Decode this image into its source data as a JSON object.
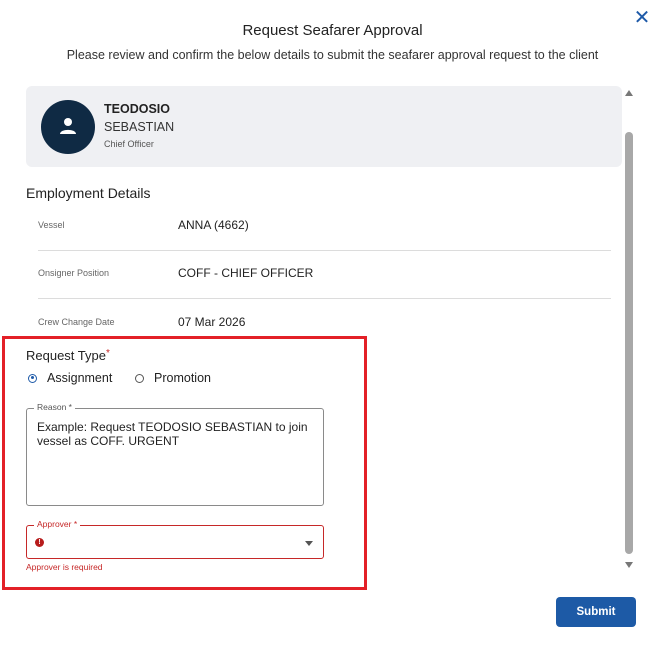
{
  "dialog": {
    "title": "Request Seafarer Approval",
    "subtitle": "Please review and confirm the below details to submit the seafarer approval request to the client",
    "close_icon": "close-icon"
  },
  "seafarer": {
    "first_name": "TEODOSIO",
    "last_name": "SEBASTIAN",
    "rank": "Chief Officer",
    "avatar_icon": "person-icon"
  },
  "employment": {
    "title": "Employment Details",
    "rows": [
      {
        "label": "Vessel",
        "value": "ANNA (4662)"
      },
      {
        "label": "Onsigner Position",
        "value": "COFF - CHIEF OFFICER"
      },
      {
        "label": "Crew Change Date",
        "value": "07 Mar 2026"
      }
    ]
  },
  "request_type": {
    "label": "Request Type",
    "required_marker": "*",
    "options": [
      {
        "label": "Assignment",
        "selected": true
      },
      {
        "label": "Promotion",
        "selected": false
      }
    ]
  },
  "reason": {
    "label": "Reason *",
    "placeholder": "Example: Request TEODOSIO SEBASTIAN to join vessel as COFF. URGENT"
  },
  "approver": {
    "label": "Approver *",
    "error": "Approver is required",
    "error_icon": "error-icon",
    "dropdown_icon": "chevron-down-icon"
  },
  "actions": {
    "submit_label": "Submit"
  },
  "colors": {
    "primary": "#1d5aa6",
    "error": "#c62828",
    "highlight": "#e32027",
    "card_bg": "#eff0f3",
    "avatar_bg": "#0f2a44"
  }
}
